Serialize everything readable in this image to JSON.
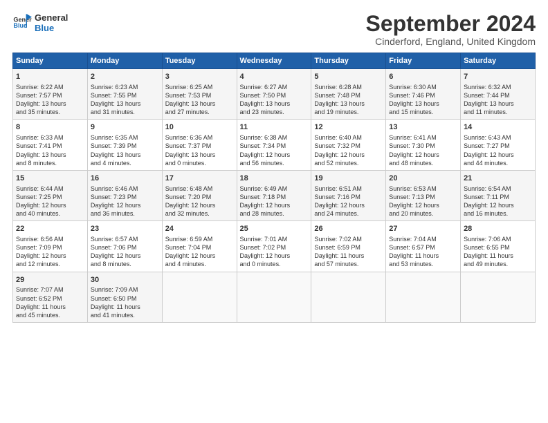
{
  "logo": {
    "line1": "General",
    "line2": "Blue"
  },
  "title": "September 2024",
  "location": "Cinderford, England, United Kingdom",
  "days_header": [
    "Sunday",
    "Monday",
    "Tuesday",
    "Wednesday",
    "Thursday",
    "Friday",
    "Saturday"
  ],
  "weeks": [
    [
      {
        "day": "1",
        "lines": [
          "Sunrise: 6:22 AM",
          "Sunset: 7:57 PM",
          "Daylight: 13 hours",
          "and 35 minutes."
        ]
      },
      {
        "day": "2",
        "lines": [
          "Sunrise: 6:23 AM",
          "Sunset: 7:55 PM",
          "Daylight: 13 hours",
          "and 31 minutes."
        ]
      },
      {
        "day": "3",
        "lines": [
          "Sunrise: 6:25 AM",
          "Sunset: 7:53 PM",
          "Daylight: 13 hours",
          "and 27 minutes."
        ]
      },
      {
        "day": "4",
        "lines": [
          "Sunrise: 6:27 AM",
          "Sunset: 7:50 PM",
          "Daylight: 13 hours",
          "and 23 minutes."
        ]
      },
      {
        "day": "5",
        "lines": [
          "Sunrise: 6:28 AM",
          "Sunset: 7:48 PM",
          "Daylight: 13 hours",
          "and 19 minutes."
        ]
      },
      {
        "day": "6",
        "lines": [
          "Sunrise: 6:30 AM",
          "Sunset: 7:46 PM",
          "Daylight: 13 hours",
          "and 15 minutes."
        ]
      },
      {
        "day": "7",
        "lines": [
          "Sunrise: 6:32 AM",
          "Sunset: 7:44 PM",
          "Daylight: 13 hours",
          "and 11 minutes."
        ]
      }
    ],
    [
      {
        "day": "8",
        "lines": [
          "Sunrise: 6:33 AM",
          "Sunset: 7:41 PM",
          "Daylight: 13 hours",
          "and 8 minutes."
        ]
      },
      {
        "day": "9",
        "lines": [
          "Sunrise: 6:35 AM",
          "Sunset: 7:39 PM",
          "Daylight: 13 hours",
          "and 4 minutes."
        ]
      },
      {
        "day": "10",
        "lines": [
          "Sunrise: 6:36 AM",
          "Sunset: 7:37 PM",
          "Daylight: 13 hours",
          "and 0 minutes."
        ]
      },
      {
        "day": "11",
        "lines": [
          "Sunrise: 6:38 AM",
          "Sunset: 7:34 PM",
          "Daylight: 12 hours",
          "and 56 minutes."
        ]
      },
      {
        "day": "12",
        "lines": [
          "Sunrise: 6:40 AM",
          "Sunset: 7:32 PM",
          "Daylight: 12 hours",
          "and 52 minutes."
        ]
      },
      {
        "day": "13",
        "lines": [
          "Sunrise: 6:41 AM",
          "Sunset: 7:30 PM",
          "Daylight: 12 hours",
          "and 48 minutes."
        ]
      },
      {
        "day": "14",
        "lines": [
          "Sunrise: 6:43 AM",
          "Sunset: 7:27 PM",
          "Daylight: 12 hours",
          "and 44 minutes."
        ]
      }
    ],
    [
      {
        "day": "15",
        "lines": [
          "Sunrise: 6:44 AM",
          "Sunset: 7:25 PM",
          "Daylight: 12 hours",
          "and 40 minutes."
        ]
      },
      {
        "day": "16",
        "lines": [
          "Sunrise: 6:46 AM",
          "Sunset: 7:23 PM",
          "Daylight: 12 hours",
          "and 36 minutes."
        ]
      },
      {
        "day": "17",
        "lines": [
          "Sunrise: 6:48 AM",
          "Sunset: 7:20 PM",
          "Daylight: 12 hours",
          "and 32 minutes."
        ]
      },
      {
        "day": "18",
        "lines": [
          "Sunrise: 6:49 AM",
          "Sunset: 7:18 PM",
          "Daylight: 12 hours",
          "and 28 minutes."
        ]
      },
      {
        "day": "19",
        "lines": [
          "Sunrise: 6:51 AM",
          "Sunset: 7:16 PM",
          "Daylight: 12 hours",
          "and 24 minutes."
        ]
      },
      {
        "day": "20",
        "lines": [
          "Sunrise: 6:53 AM",
          "Sunset: 7:13 PM",
          "Daylight: 12 hours",
          "and 20 minutes."
        ]
      },
      {
        "day": "21",
        "lines": [
          "Sunrise: 6:54 AM",
          "Sunset: 7:11 PM",
          "Daylight: 12 hours",
          "and 16 minutes."
        ]
      }
    ],
    [
      {
        "day": "22",
        "lines": [
          "Sunrise: 6:56 AM",
          "Sunset: 7:09 PM",
          "Daylight: 12 hours",
          "and 12 minutes."
        ]
      },
      {
        "day": "23",
        "lines": [
          "Sunrise: 6:57 AM",
          "Sunset: 7:06 PM",
          "Daylight: 12 hours",
          "and 8 minutes."
        ]
      },
      {
        "day": "24",
        "lines": [
          "Sunrise: 6:59 AM",
          "Sunset: 7:04 PM",
          "Daylight: 12 hours",
          "and 4 minutes."
        ]
      },
      {
        "day": "25",
        "lines": [
          "Sunrise: 7:01 AM",
          "Sunset: 7:02 PM",
          "Daylight: 12 hours",
          "and 0 minutes."
        ]
      },
      {
        "day": "26",
        "lines": [
          "Sunrise: 7:02 AM",
          "Sunset: 6:59 PM",
          "Daylight: 11 hours",
          "and 57 minutes."
        ]
      },
      {
        "day": "27",
        "lines": [
          "Sunrise: 7:04 AM",
          "Sunset: 6:57 PM",
          "Daylight: 11 hours",
          "and 53 minutes."
        ]
      },
      {
        "day": "28",
        "lines": [
          "Sunrise: 7:06 AM",
          "Sunset: 6:55 PM",
          "Daylight: 11 hours",
          "and 49 minutes."
        ]
      }
    ],
    [
      {
        "day": "29",
        "lines": [
          "Sunrise: 7:07 AM",
          "Sunset: 6:52 PM",
          "Daylight: 11 hours",
          "and 45 minutes."
        ]
      },
      {
        "day": "30",
        "lines": [
          "Sunrise: 7:09 AM",
          "Sunset: 6:50 PM",
          "Daylight: 11 hours",
          "and 41 minutes."
        ]
      },
      {
        "day": "",
        "lines": []
      },
      {
        "day": "",
        "lines": []
      },
      {
        "day": "",
        "lines": []
      },
      {
        "day": "",
        "lines": []
      },
      {
        "day": "",
        "lines": []
      }
    ]
  ]
}
